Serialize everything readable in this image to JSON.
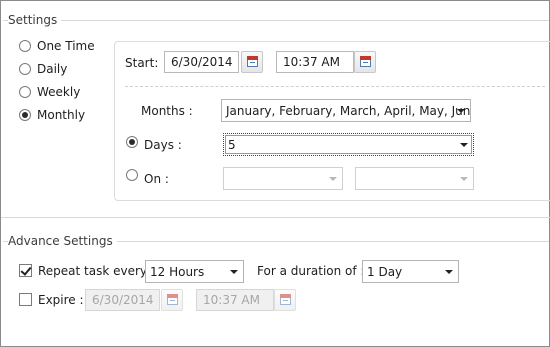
{
  "settings": {
    "title": "Settings",
    "frequency_options": [
      {
        "label": "One Time",
        "checked": false
      },
      {
        "label": "Daily",
        "checked": false
      },
      {
        "label": "Weekly",
        "checked": false
      },
      {
        "label": "Monthly",
        "checked": true
      }
    ],
    "start_label": "Start:",
    "start_date": "6/30/2014",
    "start_time": "10:37 AM",
    "months_label": "Months :",
    "months_value": "January, February, March, April, May, Jun...",
    "days_label": "Days :",
    "days_value": "5",
    "days_checked": true,
    "on_label": "On :",
    "on_checked": false,
    "on_value_1": "",
    "on_value_2": ""
  },
  "advance": {
    "title": "Advance Settings",
    "repeat_label": "Repeat task every :",
    "repeat_checked": true,
    "repeat_value": "12 Hours",
    "duration_label": "For a duration of :",
    "duration_value": "1 Day",
    "expire_label": "Expire :",
    "expire_checked": false,
    "expire_date": "6/30/2014",
    "expire_time": "10:37 AM"
  },
  "icons": {
    "calendar": "calendar-icon",
    "dropdown": "chevron-down-icon"
  },
  "colors": {
    "border": "#b9b9b9",
    "disabled_text": "#a6a6a6",
    "calendar_accent": "#c0392b"
  }
}
